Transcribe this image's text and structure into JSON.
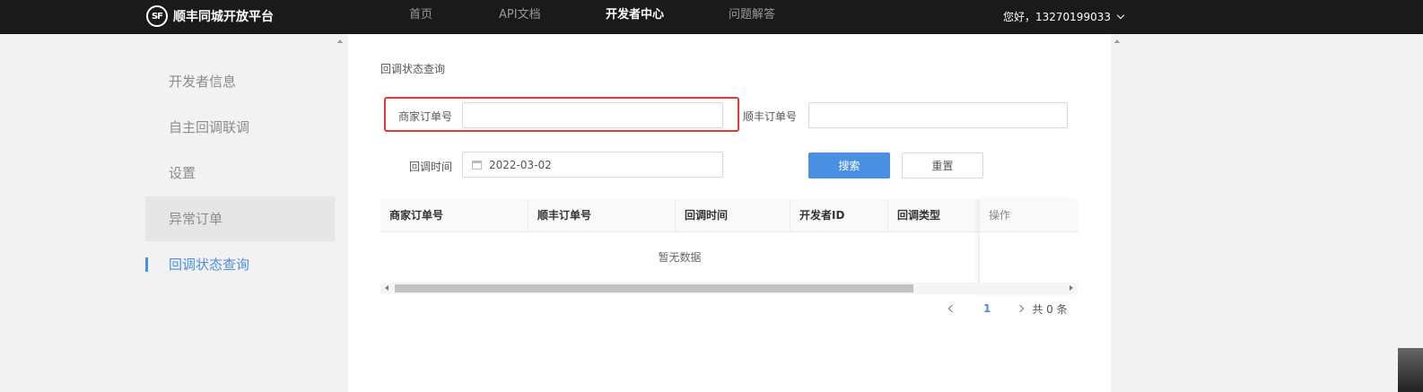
{
  "app": {
    "logo_mark": "SF",
    "logo_text": "顺丰同城开放平台"
  },
  "nav": {
    "items": [
      {
        "label": "首页"
      },
      {
        "label": "API文档"
      },
      {
        "label": "开发者中心"
      },
      {
        "label": "问题解答"
      }
    ],
    "active": "开发者中心"
  },
  "user": {
    "greeting": "您好，13270199033"
  },
  "sidebar": {
    "items": [
      {
        "label": "开发者信息"
      },
      {
        "label": "自主回调联调"
      },
      {
        "label": "设置"
      },
      {
        "label": "异常订单"
      },
      {
        "label": "回调状态查询"
      }
    ]
  },
  "page": {
    "title": "回调状态查询"
  },
  "form": {
    "merchant_order_label": "商家订单号",
    "merchant_order_value": "",
    "sf_order_label": "顺丰订单号",
    "sf_order_value": "",
    "callback_time_label": "回调时间",
    "callback_time_value": "2022-03-02",
    "search_button": "搜索",
    "reset_button": "重置"
  },
  "table": {
    "columns": [
      "商家订单号",
      "顺丰订单号",
      "回调时间",
      "开发者ID",
      "回调类型",
      "操作"
    ],
    "empty_text": "暂无数据"
  },
  "pagination": {
    "current_page": "1",
    "total_text": "共 0 条"
  },
  "colors": {
    "accent": "#4a90e2",
    "highlight_border": "#e53935",
    "topbar": "#1a1a1a"
  }
}
